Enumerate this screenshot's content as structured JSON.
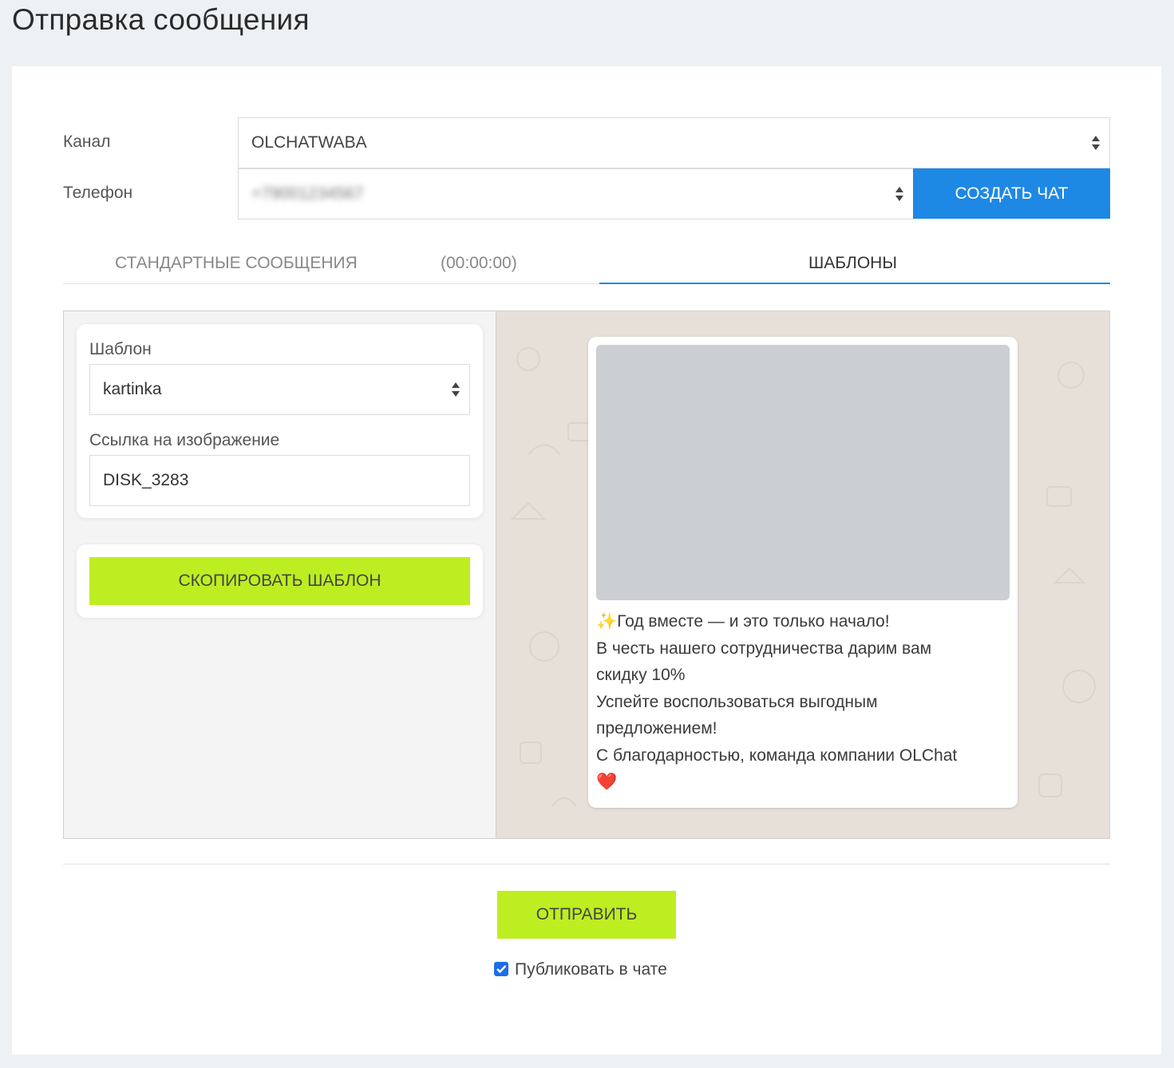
{
  "page_title": "Отправка сообщения",
  "form": {
    "channel_label": "Канал",
    "channel_value": "OLCHATWABA",
    "phone_label": "Телефон",
    "phone_value": "+79001234567",
    "create_chat_label": "Создать чат"
  },
  "tabs": [
    {
      "label": "Стандартные сообщения",
      "active": false
    },
    {
      "label": "(00:00:00)",
      "active": false
    },
    {
      "label": "Шаблоны",
      "active": true
    }
  ],
  "template_panel": {
    "template_label": "Шаблон",
    "template_value": "kartinka",
    "image_link_label": "Ссылка на изображение",
    "image_link_value": "DISK_3283",
    "copy_button_label": "Скопировать шаблон"
  },
  "preview": {
    "lines": [
      "✨Год вместе — и это только начало!",
      "В честь нашего сотрудничества дарим вам",
      "скидку 10%",
      "Успейте воспользоваться выгодным",
      "предложением!",
      "С благодарностью, команда компании OLChat",
      "❤️"
    ]
  },
  "send_button_label": "Отправить",
  "publish_label": "Публиковать в чате",
  "publish_checked": true,
  "colors": {
    "accent_blue": "#1e88e5",
    "lime": "#bdee21",
    "preview_bg": "#e7e0d8",
    "image_placeholder": "#cbced3"
  }
}
